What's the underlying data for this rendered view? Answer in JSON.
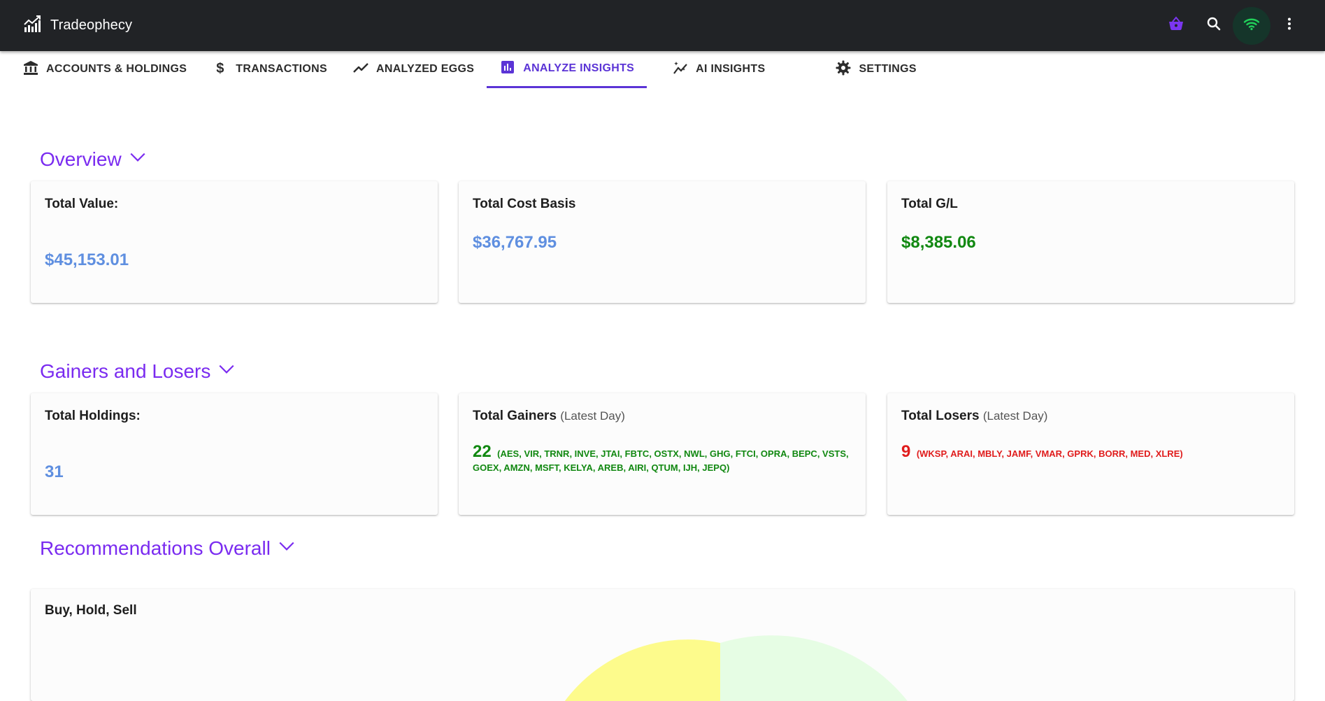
{
  "app": {
    "name": "Tradeophecy"
  },
  "icons": {
    "brand": "chart-line-icon",
    "basket": "shopping-basket-icon",
    "search": "search-icon",
    "wifi": "wifi-icon",
    "more": "more-vert-icon"
  },
  "colors": {
    "appbar": "#212326",
    "accent": "#5b34d6",
    "section": "#7a2bf0",
    "value_blue": "#5f8fe0",
    "gain_green": "#118811",
    "loss_red": "#e01c1c"
  },
  "tabs": [
    {
      "label": "ACCOUNTS & HOLDINGS",
      "icon": "bank-icon",
      "active": false
    },
    {
      "label": "TRANSACTIONS",
      "icon": "dollar-icon",
      "active": false
    },
    {
      "label": "ANALYZED EGGS",
      "icon": "trending-line-icon",
      "active": false
    },
    {
      "label": "ANALYZE INSIGHTS",
      "icon": "bar-chart-icon",
      "active": true
    },
    {
      "label": "AI INSIGHTS",
      "icon": "auto-graph-icon",
      "active": false
    },
    {
      "label": "SETTINGS",
      "icon": "gear-icon",
      "active": false
    }
  ],
  "overview": {
    "title": "Overview",
    "total_value_label": "Total Value:",
    "total_value": "$45,153.01",
    "cost_basis_label": "Total Cost Basis",
    "cost_basis": "$36,767.95",
    "gl_label": "Total G/L",
    "gl": "$8,385.06"
  },
  "gainers_losers": {
    "title": "Gainers and Losers",
    "holdings_label": "Total Holdings:",
    "holdings": "31",
    "gainers_label": "Total Gainers",
    "gainers_sub": "(Latest Day)",
    "gainers_count": "22",
    "gainers_list": "(AES, VIR, TRNR, INVE, JTAI, FBTC, OSTX, NWL, GHG, FTCI, OPRA, BEPC, VSTS, GOEX, AMZN, MSFT, KELYA, AREB, AIRI, QTUM, IJH, JEPQ)",
    "losers_label": "Total Losers",
    "losers_sub": "(Latest Day)",
    "losers_count": "9",
    "losers_list": "(WKSP, ARAI, MBLY, JAMF, VMAR, GPRK, BORR, MED, XLRE)"
  },
  "recommendations": {
    "title": "Recommendations Overall",
    "card_title": "Buy, Hold, Sell"
  }
}
